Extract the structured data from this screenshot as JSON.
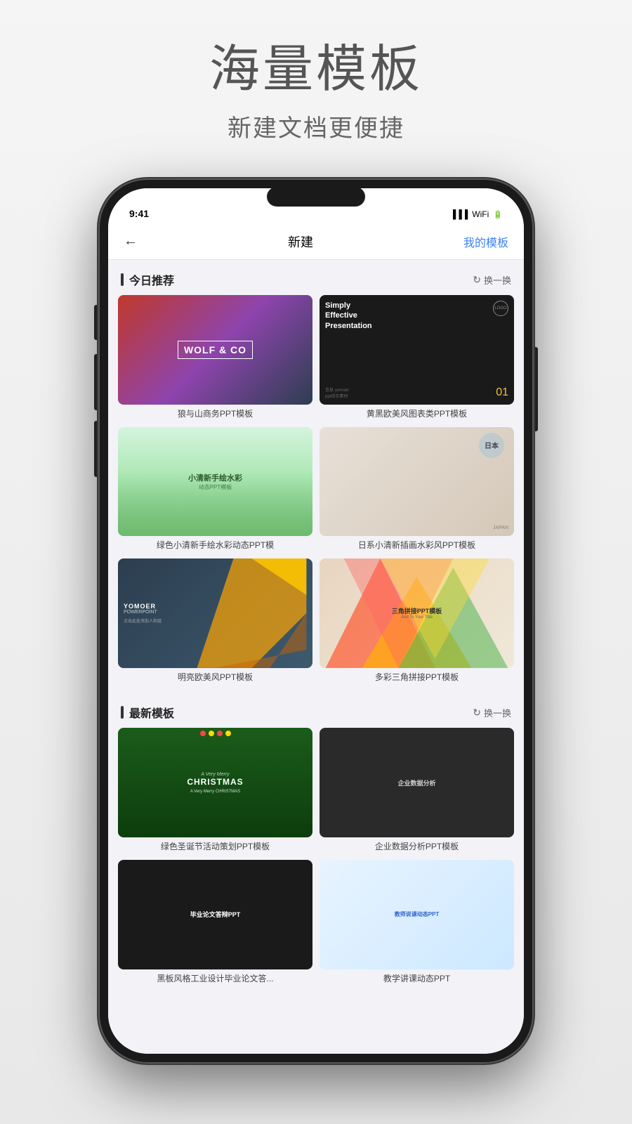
{
  "page": {
    "title_main": "海量模板",
    "title_sub": "新建文档更便捷"
  },
  "app": {
    "nav": {
      "back_icon": "←",
      "title": "新建",
      "action": "我的模板"
    },
    "sections": [
      {
        "id": "today-recommend",
        "title": "今日推荐",
        "action": "换一换",
        "templates": [
          {
            "id": "wolf-co",
            "label": "狼与山商务PPT模板",
            "thumb_type": "wolf",
            "title_text": "WOLF & CO"
          },
          {
            "id": "simply-effective",
            "label": "黄黑欧美风图表类PPT模板",
            "thumb_type": "simply",
            "title_text": "Simply Effective Presentation"
          },
          {
            "id": "watercolor-green",
            "label": "绿色小清新手绘水彩动态PPT模",
            "thumb_type": "watercolor-green",
            "main_text": "小清新手绘水彩",
            "sub_text": "动态PPT模板"
          },
          {
            "id": "japan",
            "label": "日系小清新插画水彩风PPT模板",
            "thumb_type": "japan",
            "kanji": "日本"
          },
          {
            "id": "yomoer",
            "label": "明亮欧美风PPT模板",
            "thumb_type": "yomoer",
            "brand": "YOMOER",
            "sub": "POWERPOINT"
          },
          {
            "id": "triangle",
            "label": "多彩三角拼接PPT模板",
            "thumb_type": "triangle",
            "main_text": "三角拼接PPT模板",
            "sub_text": "Add To Your Title"
          }
        ]
      },
      {
        "id": "latest",
        "title": "最新模板",
        "action": "换一换",
        "templates": [
          {
            "id": "christmas",
            "label": "绿色圣诞节活动策划PPT模板",
            "thumb_type": "christmas",
            "title": "A Very Merry CHRISTMAS"
          },
          {
            "id": "enterprise",
            "label": "企业数据分析PPT模板",
            "thumb_type": "enterprise",
            "title": "企业数据分析"
          },
          {
            "id": "graduation",
            "label": "黑板风格工业设计毕业论文答...",
            "thumb_type": "graduation",
            "title": "毕业论文答辩PPT"
          },
          {
            "id": "teacher",
            "label": "教学讲课动态PPT",
            "thumb_type": "teacher",
            "title": "教师说课动态PPT"
          }
        ]
      }
    ]
  }
}
